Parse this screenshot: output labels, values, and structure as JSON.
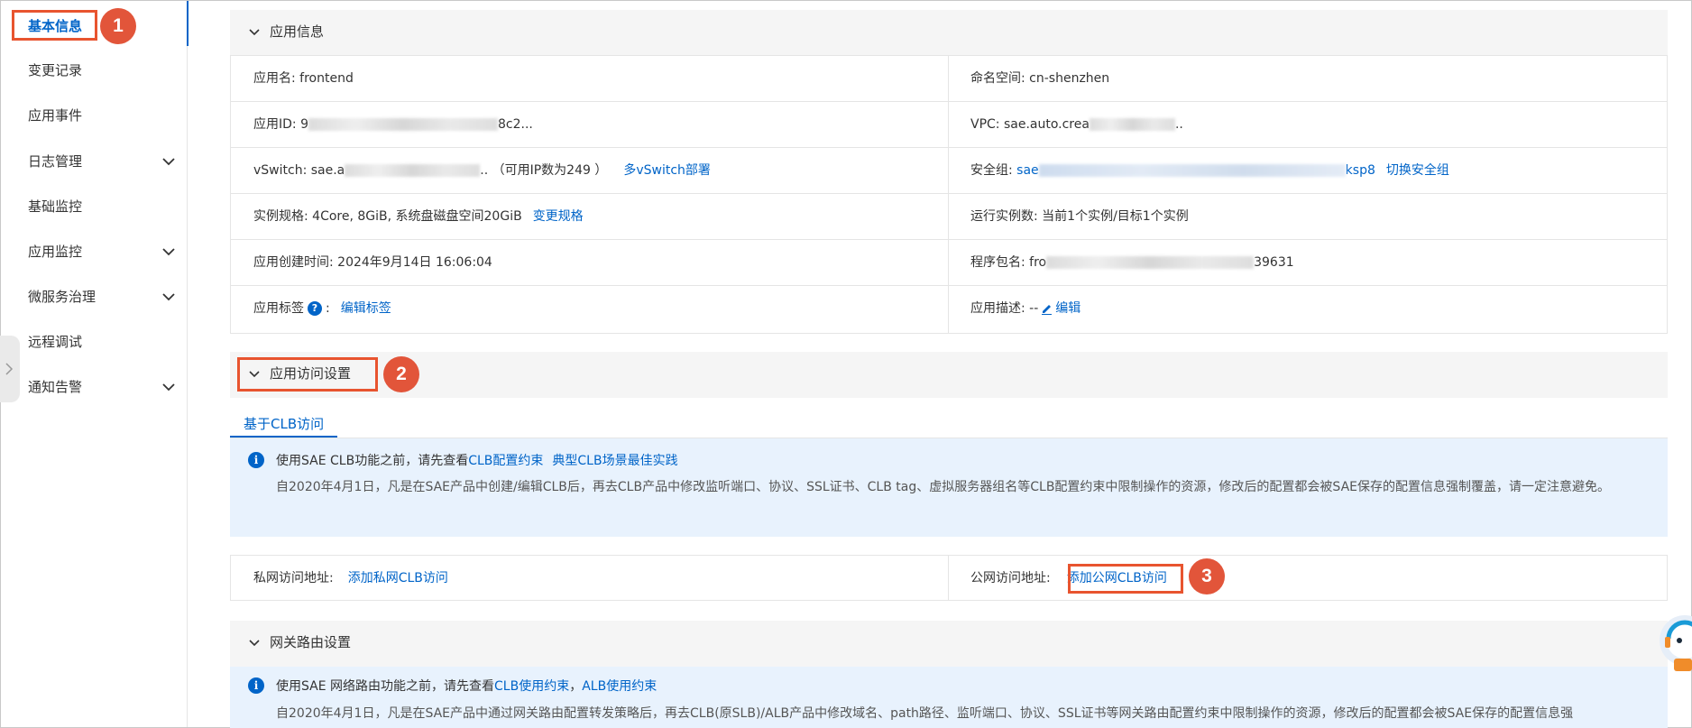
{
  "sidebar": {
    "items": [
      {
        "label": "基本信息",
        "active": true,
        "expandable": false
      },
      {
        "label": "变更记录",
        "active": false,
        "expandable": false
      },
      {
        "label": "应用事件",
        "active": false,
        "expandable": false
      },
      {
        "label": "日志管理",
        "active": false,
        "expandable": true
      },
      {
        "label": "基础监控",
        "active": false,
        "expandable": false
      },
      {
        "label": "应用监控",
        "active": false,
        "expandable": true
      },
      {
        "label": "微服务治理",
        "active": false,
        "expandable": true
      },
      {
        "label": "远程调试",
        "active": false,
        "expandable": false
      },
      {
        "label": "通知告警",
        "active": false,
        "expandable": true
      }
    ]
  },
  "callouts": [
    "1",
    "2",
    "3"
  ],
  "app_info": {
    "title": "应用信息",
    "app_name": "应用名: frontend",
    "namespace": "命名空间: cn-shenzhen",
    "app_id_prefix": "应用ID: 9",
    "app_id_suffix": "8c2...",
    "vpc_prefix": "VPC: sae.auto.crea",
    "vpc_suffix": "..",
    "vswitch_prefix": "vSwitch: sae.a",
    "vswitch_suffix": "..  （可用IP数为249 ）",
    "vswitch_link": "多vSwitch部署",
    "security_group_label": "安全组: ",
    "security_group_prefix": "sae",
    "security_group_suffix": "ksp8",
    "security_group_link": "切换安全组",
    "spec": "实例规格: 4Core, 8GiB, 系统盘磁盘空间20GiB",
    "spec_link": "变更规格",
    "instances": "运行实例数: 当前1个实例/目标1个实例",
    "created": "应用创建时间: 2024年9月14日 16:06:04",
    "package_prefix": "程序包名: fro",
    "package_suffix": "39631",
    "tags_label": "应用标签",
    "tags_link": "编辑标签",
    "desc_label": "应用描述: --",
    "desc_link": "编辑"
  },
  "access": {
    "title": "应用访问设置",
    "tab": "基于CLB访问",
    "notice_prefix": "使用SAE CLB功能之前，请先查看",
    "notice_link1": "CLB配置约束",
    "notice_link2": "典型CLB场景最佳实践",
    "notice_body": "自2020年4月1日，凡是在SAE产品中创建/编辑CLB后，再去CLB产品中修改监听端口、协议、SSL证书、CLB tag、虚拟服务器组名等CLB配置约束中限制操作的资源，修改后的配置都会被SAE保存的配置信息强制覆盖，请一定注意避免。",
    "private_label": "私网访问地址:",
    "private_link": "添加私网CLB访问",
    "public_label": "公网访问地址:",
    "public_link": "添加公网CLB访问"
  },
  "gateway": {
    "title": "网关路由设置",
    "notice_prefix": "使用SAE 网络路由功能之前，请先查看",
    "notice_link1": "CLB使用约束",
    "notice_sep": "，",
    "notice_link2": "ALB使用约束",
    "notice_body": "自2020年4月1日，凡是在SAE产品中通过网关路由配置转发策略后，再去CLB(原SLB)/ALB产品中修改域名、path路径、监听端口、协议、SSL证书等网关路由配置约束中限制操作的资源，修改后的配置都会被SAE保存的配置信息强"
  },
  "colors": {
    "accent": "#0064c8",
    "callout": "#e2553a",
    "highlight_border": "#e8542f",
    "notice_bg": "#e8f2fd"
  }
}
